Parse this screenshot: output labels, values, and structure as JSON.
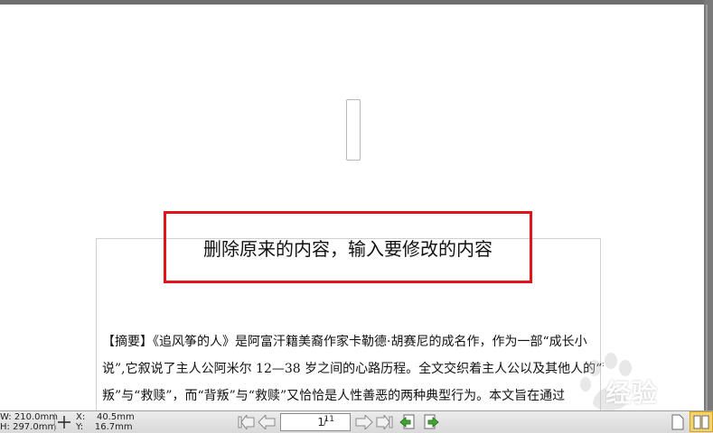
{
  "editor": {
    "callout_text": "删除原来的内容，输入要修改的内容",
    "body_lines": [
      "【摘要】《追风筝的人》是阿富汗籍美裔作家卡勒德·胡赛尼的成名作，作为一部“成长小",
      "说”,它叙说了主人公阿米尔 12—38 岁之间的心路历程。全文交织着主人公以及其他人的“背",
      "叛”与“救赎”，而“背叛”与“救赎”又恰恰是人性善恶的两种典型行为。本文旨在通过"
    ]
  },
  "watermark": {
    "text": "经验",
    "brand": "Baidu"
  },
  "statusbar": {
    "width_label": "W:",
    "width_value": "210.0mm",
    "height_label": "H:",
    "height_value": "297.0mm",
    "x_label": "X:",
    "x_value": "40.5mm",
    "y_label": "Y:",
    "y_value": "16.7mm",
    "current_page": "1",
    "total_pages": "11"
  },
  "colors": {
    "callout_border": "#e0141a",
    "active_view": "#f6d36a"
  }
}
